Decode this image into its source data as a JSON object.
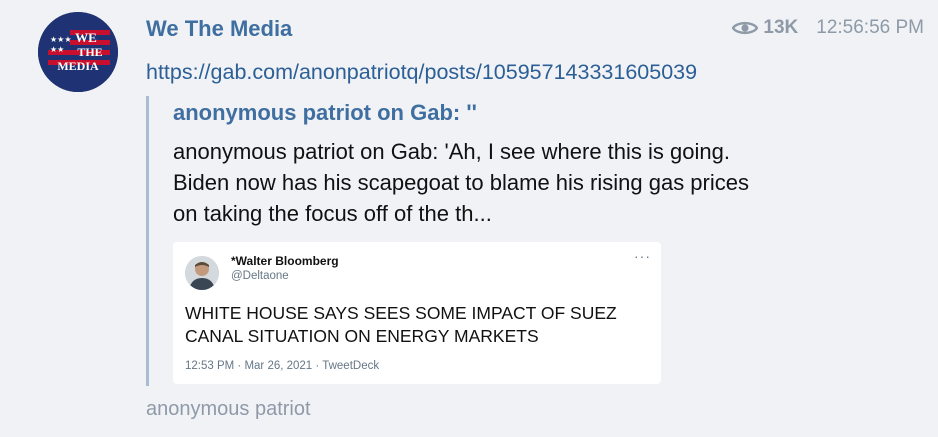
{
  "channel": {
    "name": "We The Media",
    "avatar_text": [
      "WE",
      "THE",
      "MEDIA"
    ]
  },
  "message": {
    "views": "13K",
    "time": "12:56:56 PM",
    "link": "https://gab.com/anonpatriotq/posts/105957143331605039",
    "preview": {
      "title": "anonymous patriot on Gab: ''",
      "text": "anonymous patriot on Gab: 'Ah, I see where this is going. Biden now has his scapegoat to blame his rising gas prices on taking the focus off of the th..."
    },
    "tweet": {
      "name": "*Walter Bloomberg",
      "handle": "@Deltaone",
      "more": "···",
      "text": "WHITE HOUSE SAYS SEES SOME IMPACT OF SUEZ CANAL SITUATION ON ENERGY MARKETS",
      "meta": "12:53 PM · Mar 26, 2021 · TweetDeck"
    },
    "author": "anonymous patriot"
  },
  "colors": {
    "accent": "#3f6ea0",
    "link": "#2c5f96",
    "muted": "#8e9aa8",
    "background": "#f0f2f5"
  }
}
